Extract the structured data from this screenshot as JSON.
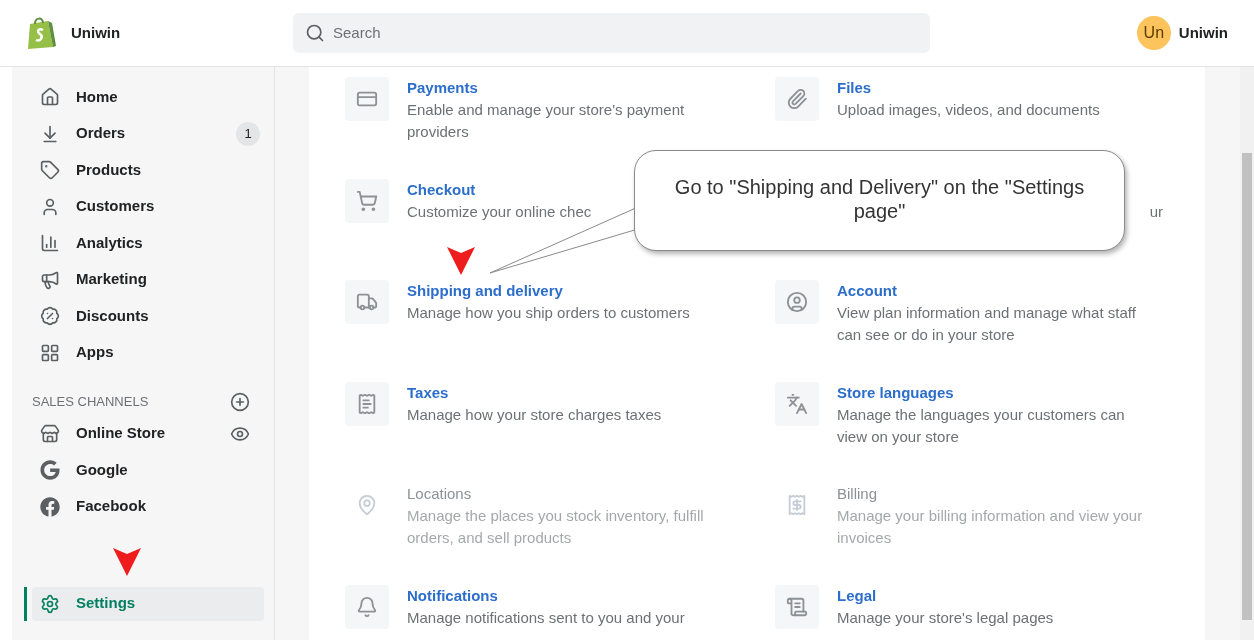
{
  "header": {
    "store_name": "Uniwin",
    "search": {
      "placeholder": "Search"
    },
    "user": {
      "initials": "Un",
      "name": "Uniwin"
    }
  },
  "sidebar": {
    "items": [
      {
        "label": "Home",
        "selected": false
      },
      {
        "label": "Orders",
        "selected": false,
        "badge": "1"
      },
      {
        "label": "Products",
        "selected": false
      },
      {
        "label": "Customers",
        "selected": false
      },
      {
        "label": "Analytics",
        "selected": false
      },
      {
        "label": "Marketing",
        "selected": false
      },
      {
        "label": "Discounts",
        "selected": false
      },
      {
        "label": "Apps",
        "selected": false
      }
    ],
    "sales_channels": {
      "heading": "SALES CHANNELS",
      "items": [
        {
          "label": "Online Store",
          "selected": false
        },
        {
          "label": "Google",
          "selected": false
        },
        {
          "label": "Facebook",
          "selected": false
        }
      ]
    },
    "settings": {
      "label": "Settings",
      "selected": true
    }
  },
  "settings_grid": [
    [
      {
        "title": "Payments",
        "description": "Enable and manage your store's payment providers",
        "disabled": false
      },
      {
        "title": "Files",
        "description": "Upload images, videos, and documents",
        "disabled": false
      }
    ],
    [
      {
        "title": "Checkout",
        "description": "Customize your online chec",
        "disabled": false
      },
      {
        "description": "ur"
      }
    ],
    [
      {
        "title": "Shipping and delivery",
        "description": "Manage how you ship orders to customers",
        "disabled": false
      },
      {
        "title": "Account",
        "description": "View plan information and manage what staff can see or do in your store",
        "disabled": false
      }
    ],
    [
      {
        "title": "Taxes",
        "description": "Manage how your store charges taxes",
        "disabled": false
      },
      {
        "title": "Store languages",
        "description": "Manage the languages your customers can view on your store",
        "disabled": false
      }
    ],
    [
      {
        "title": "Locations",
        "description": "Manage the places you stock inventory, fulfill orders, and sell products",
        "disabled": true
      },
      {
        "title": "Billing",
        "description": "Manage your billing information and view your invoices",
        "disabled": true
      }
    ],
    [
      {
        "title": "Notifications",
        "description": "Manage notifications sent to you and your",
        "disabled": false
      },
      {
        "title": "Legal",
        "description": "Manage your store's legal pages",
        "disabled": false
      }
    ]
  ],
  "callout": {
    "text": "Go to \"Shipping and Delivery\" on the \"Settings page\""
  }
}
